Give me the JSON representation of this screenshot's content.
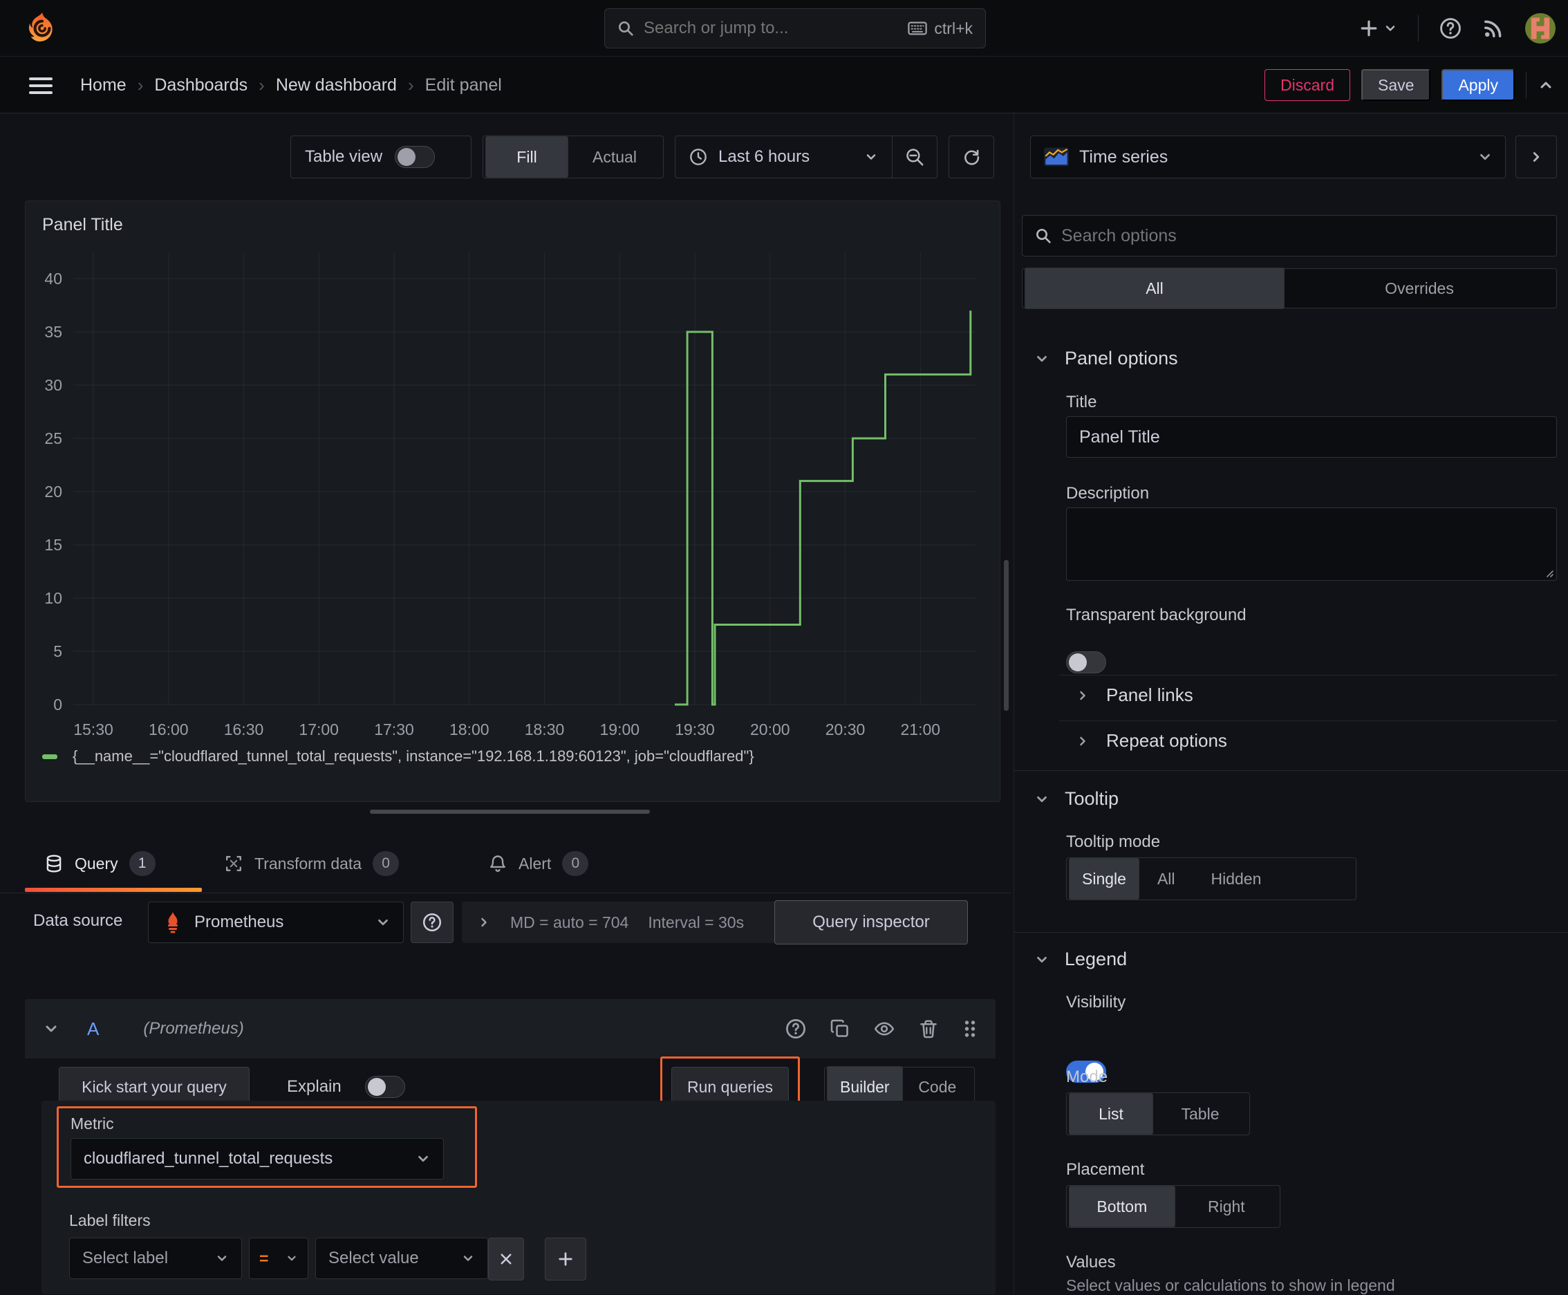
{
  "colors": {
    "accent_blue": "#3871dc",
    "series_green": "#73bf69",
    "highlight_orange": "#f0642e",
    "danger_pink": "#e3356b",
    "operator_orange": "#eb7b18",
    "tab_underline": "#f2503b"
  },
  "topnav": {
    "search_placeholder": "Search or jump to...",
    "search_shortcut": "ctrl+k"
  },
  "breadcrumb": {
    "items": [
      "Home",
      "Dashboards",
      "New dashboard",
      "Edit panel"
    ]
  },
  "header_actions": {
    "discard": "Discard",
    "save": "Save",
    "apply": "Apply"
  },
  "panel_toolbar": {
    "table_view_label": "Table view",
    "fill_label": "Fill",
    "actual_label": "Actual",
    "time_range_label": "Last 6 hours"
  },
  "viz_picker": {
    "label": "Time series"
  },
  "panel": {
    "title": "Panel Title"
  },
  "chart_data": {
    "type": "line",
    "title": "Panel Title",
    "x_range": [
      "15:22",
      "21:22"
    ],
    "x_ticks": [
      "15:30",
      "16:00",
      "16:30",
      "17:00",
      "17:30",
      "18:00",
      "18:30",
      "19:00",
      "19:30",
      "20:00",
      "20:30",
      "21:00"
    ],
    "y_ticks": [
      0,
      5,
      10,
      15,
      20,
      25,
      30,
      35,
      40
    ],
    "ylim": [
      0,
      40
    ],
    "grid": true,
    "legend_position": "bottom",
    "series": [
      {
        "name": "{__name__=\"cloudflared_tunnel_total_requests\", instance=\"192.168.1.189:60123\", job=\"cloudflared\"}",
        "color": "#73bf69",
        "points": [
          [
            "19:22",
            0
          ],
          [
            "19:27",
            0
          ],
          [
            "19:27",
            35
          ],
          [
            "19:37",
            35
          ],
          [
            "19:37",
            0
          ],
          [
            "19:38",
            0
          ],
          [
            "19:38",
            7.5
          ],
          [
            "20:12",
            7.5
          ],
          [
            "20:12",
            21
          ],
          [
            "20:33",
            21
          ],
          [
            "20:33",
            25
          ],
          [
            "20:46",
            25
          ],
          [
            "20:46",
            31
          ],
          [
            "21:20",
            31
          ],
          [
            "21:20",
            37
          ]
        ]
      }
    ]
  },
  "query_tabs": {
    "query_label": "Query",
    "query_count": "1",
    "transform_label": "Transform data",
    "transform_count": "0",
    "alert_label": "Alert",
    "alert_count": "0"
  },
  "datasource_bar": {
    "label": "Data source",
    "name": "Prometheus",
    "stat_md": "MD = auto = 704",
    "stat_interval": "Interval = 30s",
    "query_inspector_label": "Query inspector"
  },
  "query_editor": {
    "ref_id": "A",
    "ds_hint": "(Prometheus)",
    "kick_start_label": "Kick start your query",
    "explain_label": "Explain",
    "run_queries_label": "Run queries",
    "builder_label": "Builder",
    "code_label": "Code",
    "metric_label": "Metric",
    "metric_value": "cloudflared_tunnel_total_requests",
    "label_filters_label": "Label filters",
    "select_label_placeholder": "Select label",
    "operator": "=",
    "select_value_placeholder": "Select value"
  },
  "options_pane": {
    "search_placeholder": "Search options",
    "tab_all": "All",
    "tab_overrides": "Overrides",
    "panel_options": {
      "header": "Panel options",
      "title_label": "Title",
      "title_value": "Panel Title",
      "description_label": "Description",
      "transparent_label": "Transparent background",
      "panel_links_label": "Panel links",
      "repeat_options_label": "Repeat options"
    },
    "tooltip": {
      "header": "Tooltip",
      "mode_label": "Tooltip mode",
      "modes": [
        "Single",
        "All",
        "Hidden"
      ]
    },
    "legend": {
      "header": "Legend",
      "visibility_label": "Visibility",
      "mode_label": "Mode",
      "modes": [
        "List",
        "Table"
      ],
      "placement_label": "Placement",
      "placements": [
        "Bottom",
        "Right"
      ],
      "values_label": "Values",
      "values_hint": "Select values or calculations to show in legend"
    }
  }
}
